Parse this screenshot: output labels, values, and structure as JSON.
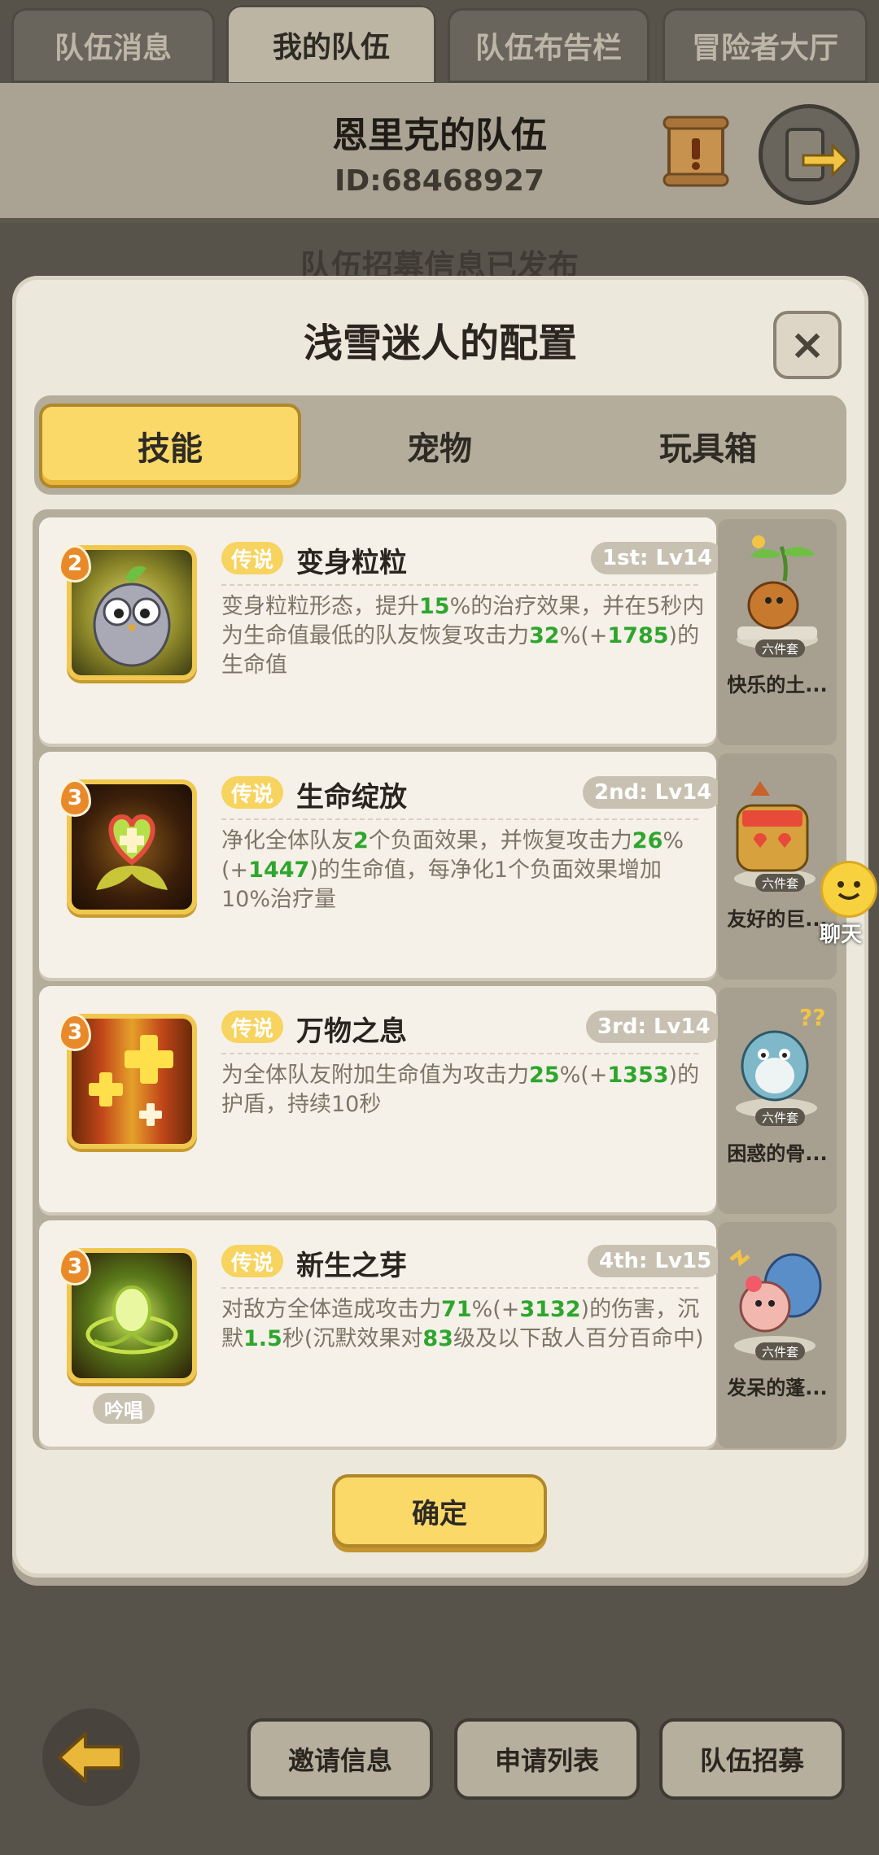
{
  "top_tabs": [
    "队伍消息",
    "我的队伍",
    "队伍布告栏",
    "冒险者大厅"
  ],
  "team": {
    "name": "恩里克的队伍",
    "id": "ID:68468927"
  },
  "notice": "队伍招募信息已发布",
  "modal": {
    "title": "浅雪迷人的配置",
    "close_label": "×",
    "tabs": [
      "技能",
      "宠物",
      "玩具箱"
    ],
    "confirm_label": "确定"
  },
  "skills": [
    {
      "level_badge": "2",
      "tag": "传说",
      "name": "变身粒粒",
      "slot": "1st: Lv14",
      "desc": [
        {
          "t": "变身粒粒形态，提升"
        },
        {
          "t": "15",
          "n": true
        },
        {
          "t": "%的治疗效果，并在5秒内为生命值最低的队友恢复攻击力"
        },
        {
          "t": "32",
          "n": true
        },
        {
          "t": "%(+"
        },
        {
          "t": "1785",
          "n": true
        },
        {
          "t": ")的生命值"
        }
      ]
    },
    {
      "level_badge": "3",
      "tag": "传说",
      "name": "生命绽放",
      "slot": "2nd: Lv14",
      "desc": [
        {
          "t": "净化全体队友"
        },
        {
          "t": "2",
          "n": true
        },
        {
          "t": "个负面效果，并恢复攻击力"
        },
        {
          "t": "26",
          "n": true
        },
        {
          "t": "%(+"
        },
        {
          "t": "1447",
          "n": true
        },
        {
          "t": ")的生命值，每净化1个负面效果增加10%治疗量"
        }
      ]
    },
    {
      "level_badge": "3",
      "tag": "传说",
      "name": "万物之息",
      "slot": "3rd: Lv14",
      "desc": [
        {
          "t": "为全体队友附加生命值为攻击力"
        },
        {
          "t": "25",
          "n": true
        },
        {
          "t": "%(+"
        },
        {
          "t": "1353",
          "n": true
        },
        {
          "t": ")的护盾，持续10秒"
        }
      ]
    },
    {
      "level_badge": "3",
      "tag": "传说",
      "name": "新生之芽",
      "slot": "4th: Lv15",
      "chant": "吟唱",
      "desc": [
        {
          "t": "对敌方全体造成攻击力"
        },
        {
          "t": "71",
          "n": true
        },
        {
          "t": "%(+"
        },
        {
          "t": "3132",
          "n": true
        },
        {
          "t": ")的伤害，沉默"
        },
        {
          "t": "1.5",
          "n": true
        },
        {
          "t": "秒(沉默效果对"
        },
        {
          "t": "83",
          "n": true
        },
        {
          "t": "级及以下敌人百分百命中)"
        }
      ]
    }
  ],
  "side_items": [
    {
      "label": "快乐的土...",
      "tag": "六件套"
    },
    {
      "label": "友好的巨...",
      "tag": "六件套"
    },
    {
      "label": "困惑的骨...",
      "tag": "六件套"
    },
    {
      "label": "发呆的蓬...",
      "tag": "六件套"
    }
  ],
  "chat_label": "聊天",
  "bottom_buttons": [
    "邀请信息",
    "申请列表",
    "队伍招募"
  ],
  "colors": {
    "accent_yellow": "#fbd969",
    "green_number": "#2ea62e",
    "badge_orange": "#e98a2a"
  }
}
